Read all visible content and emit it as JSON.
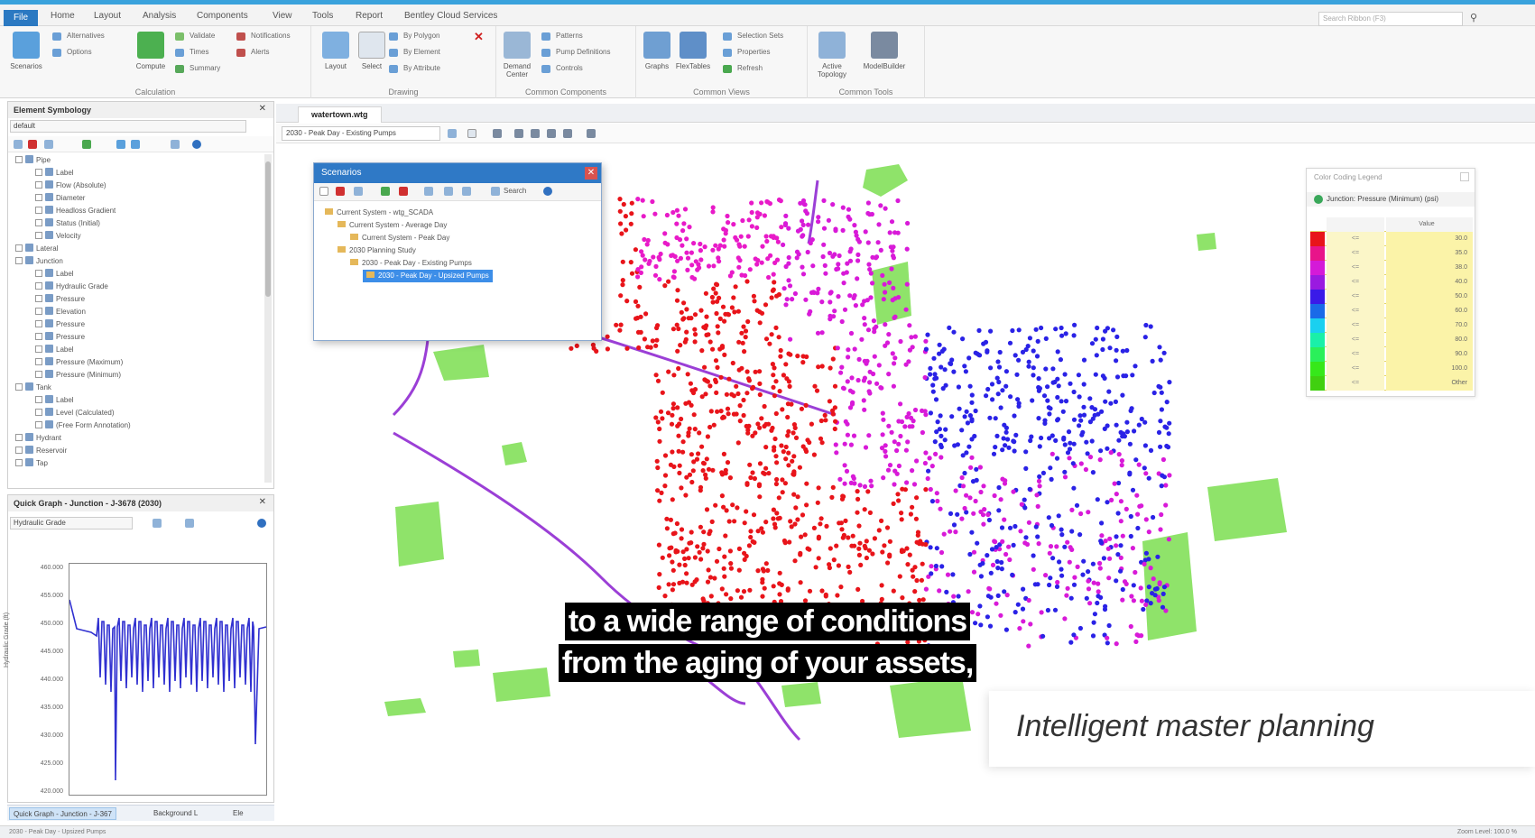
{
  "ribbon": {
    "tabs": [
      "File",
      "Home",
      "Layout",
      "Analysis",
      "Components",
      "View",
      "Tools",
      "Report",
      "Bentley Cloud Services"
    ],
    "search_placeholder": "Search Ribbon (F3)",
    "groups": [
      {
        "name": "Calculation",
        "big": [
          "Scenarios",
          "Compute"
        ],
        "small": [
          "Alternatives",
          "Options",
          "Validate",
          "Times",
          "Summary",
          "Notifications",
          "Alerts"
        ]
      },
      {
        "name": "Drawing",
        "big": [
          "Layout",
          "Select"
        ],
        "small": [
          "By Polygon",
          "By Element",
          "By Attribute"
        ]
      },
      {
        "name": "Common Components",
        "big": [
          "Demand Center"
        ],
        "small": [
          "Patterns",
          "Pump Definitions",
          "Controls"
        ]
      },
      {
        "name": "Common Views",
        "big": [
          "Graphs",
          "FlexTables"
        ],
        "small": [
          "Selection Sets",
          "Properties",
          "Refresh"
        ]
      },
      {
        "name": "Common Tools",
        "big": [
          "Active Topology",
          "ModelBuilder"
        ],
        "small": []
      }
    ]
  },
  "symbology_pane": {
    "title": "Element Symbology",
    "dropdown": "default",
    "tree": [
      {
        "label": "Pipe",
        "level": 0
      },
      {
        "label": "Label",
        "level": 1
      },
      {
        "label": "Flow (Absolute)",
        "level": 1
      },
      {
        "label": "Diameter",
        "level": 1
      },
      {
        "label": "Headloss Gradient",
        "level": 1
      },
      {
        "label": "Status (Initial)",
        "level": 1
      },
      {
        "label": "Velocity",
        "level": 1
      },
      {
        "label": "Lateral",
        "level": 0
      },
      {
        "label": "Junction",
        "level": 0
      },
      {
        "label": "Label",
        "level": 1
      },
      {
        "label": "Hydraulic Grade",
        "level": 1
      },
      {
        "label": "Pressure",
        "level": 1
      },
      {
        "label": "Elevation",
        "level": 1
      },
      {
        "label": "Pressure",
        "level": 1
      },
      {
        "label": "Pressure",
        "level": 1
      },
      {
        "label": "Label",
        "level": 1
      },
      {
        "label": "Pressure (Maximum)",
        "level": 1
      },
      {
        "label": "Pressure (Minimum)",
        "level": 1
      },
      {
        "label": "Tank",
        "level": 0
      },
      {
        "label": "Label",
        "level": 1
      },
      {
        "label": "Level (Calculated)",
        "level": 1
      },
      {
        "label": "(Free Form Annotation)",
        "level": 1
      },
      {
        "label": "Hydrant",
        "level": 0
      },
      {
        "label": "Reservoir",
        "level": 0
      },
      {
        "label": "Tap",
        "level": 0
      }
    ]
  },
  "graph_pane": {
    "title": "Quick Graph - Junction - J-3678 (2030)",
    "dropdown": "Hydraulic Grade",
    "y_title": "Hydraulic Grade (ft)",
    "y_ticks": [
      "460.000",
      "455.000",
      "450.000",
      "445.000",
      "440.000",
      "435.000",
      "430.000",
      "425.000",
      "420.000"
    ],
    "tabs": [
      "Quick Graph - Junction - J-367",
      "Background L",
      "Ele"
    ]
  },
  "document": {
    "tab": "watertown.wtg",
    "scenario_select": "2030 - Peak Day - Existing Pumps"
  },
  "scenarios_dialog": {
    "title": "Scenarios",
    "search_label": "Search",
    "tree": [
      {
        "label": "Current System - wtg_SCADA",
        "level": 0,
        "selected": false
      },
      {
        "label": "Current System - Average Day",
        "level": 1,
        "selected": false
      },
      {
        "label": "Current System - Peak Day",
        "level": 2,
        "selected": false
      },
      {
        "label": "2030 Planning Study",
        "level": 1,
        "selected": false
      },
      {
        "label": "2030 - Peak Day - Existing Pumps",
        "level": 2,
        "selected": false
      },
      {
        "label": "2030 - Peak Day - Upsized Pumps",
        "level": 3,
        "selected": true
      }
    ]
  },
  "legend": {
    "title": "Color Coding Legend",
    "field": "Junction: Pressure (Minimum) (psi)",
    "header_value": "Value",
    "rows": [
      {
        "color": "#e8141a",
        "op": "<=",
        "value": "30.0"
      },
      {
        "color": "#e8148a",
        "op": "<=",
        "value": "35.0"
      },
      {
        "color": "#d41ad8",
        "op": "<=",
        "value": "38.0"
      },
      {
        "color": "#9a1ae0",
        "op": "<=",
        "value": "40.0"
      },
      {
        "color": "#3a1ae8",
        "op": "<=",
        "value": "50.0"
      },
      {
        "color": "#1a6ae8",
        "op": "<=",
        "value": "60.0"
      },
      {
        "color": "#1ad0f0",
        "op": "<=",
        "value": "70.0"
      },
      {
        "color": "#1af0a8",
        "op": "<=",
        "value": "80.0"
      },
      {
        "color": "#2af05a",
        "op": "<=",
        "value": "90.0"
      },
      {
        "color": "#36e81a",
        "op": "<=",
        "value": "100.0"
      },
      {
        "color": "#40d010",
        "op": "<=",
        "value": "Other"
      }
    ]
  },
  "captions": {
    "line1": "to a wide range of conditions",
    "line2": "from the aging of your assets,",
    "overlay": "Intelligent master planning"
  },
  "status": {
    "left": "2030 - Peak Day - Upsized Pumps",
    "right": "Zoom Level: 100.0 %"
  },
  "colors": {
    "accent": "#2b79c2",
    "park_green": "#8fe36a",
    "road_purple": "#9b3fd6"
  }
}
